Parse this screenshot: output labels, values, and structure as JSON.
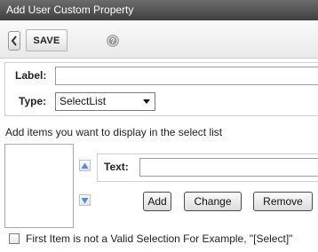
{
  "window": {
    "title": "Add User Custom Property"
  },
  "toolbar": {
    "back_icon": "chevron-left-icon",
    "save_label": "SAVE",
    "help_icon": "help-icon"
  },
  "form": {
    "label_caption": "Label:",
    "label_value": "",
    "type_caption": "Type:",
    "type_value": "SelectList"
  },
  "select_list": {
    "instructions": "Add items you want to display in the select list",
    "items": [],
    "move_up_icon": "arrow-up-icon",
    "move_down_icon": "arrow-down-icon",
    "text_caption": "Text:",
    "text_value": "",
    "add_label": "Add",
    "change_label": "Change",
    "remove_label": "Remove"
  },
  "options": {
    "first_item_invalid_label": "First Item is not a Valid Selection For Example, \"[Select]\"",
    "first_item_invalid_checked": false
  },
  "colors": {
    "titlebar": "#4f4f4f",
    "arrow_blue": "#5b88c8"
  }
}
